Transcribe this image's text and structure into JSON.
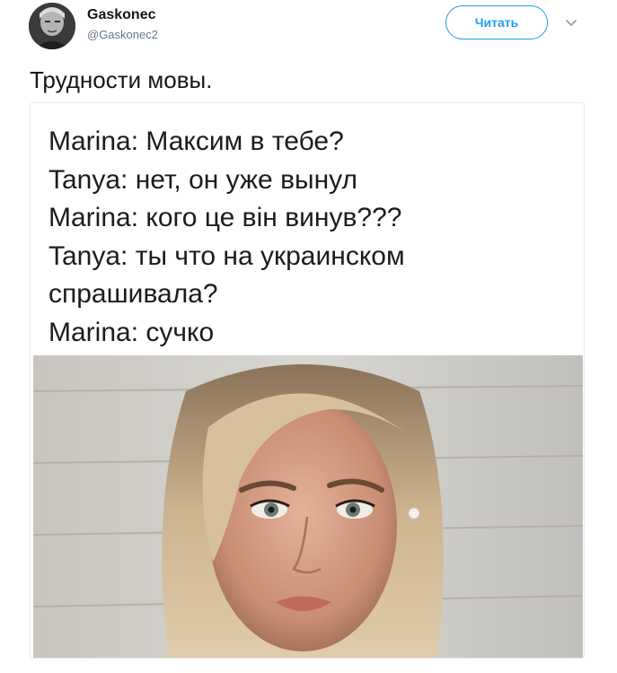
{
  "author": {
    "name": "Gaskonec",
    "handle": "@Gaskonec2",
    "avatar_icon": "avatar-portrait"
  },
  "follow_button_label": "Читать",
  "menu_icon": "chevron-down-icon",
  "tweet_text": "Трудности мовы.",
  "meme": {
    "lines": [
      "Marina: Максим в тебе?",
      "Tanya: нет, он уже вынул",
      "Marina: кого це він винув???",
      "Tanya: ты что на украинском",
      "спрашивала?",
      "Marina: сучко"
    ]
  },
  "colors": {
    "accent": "#1da1f2",
    "text": "#14171a",
    "secondary_text": "#657786"
  }
}
